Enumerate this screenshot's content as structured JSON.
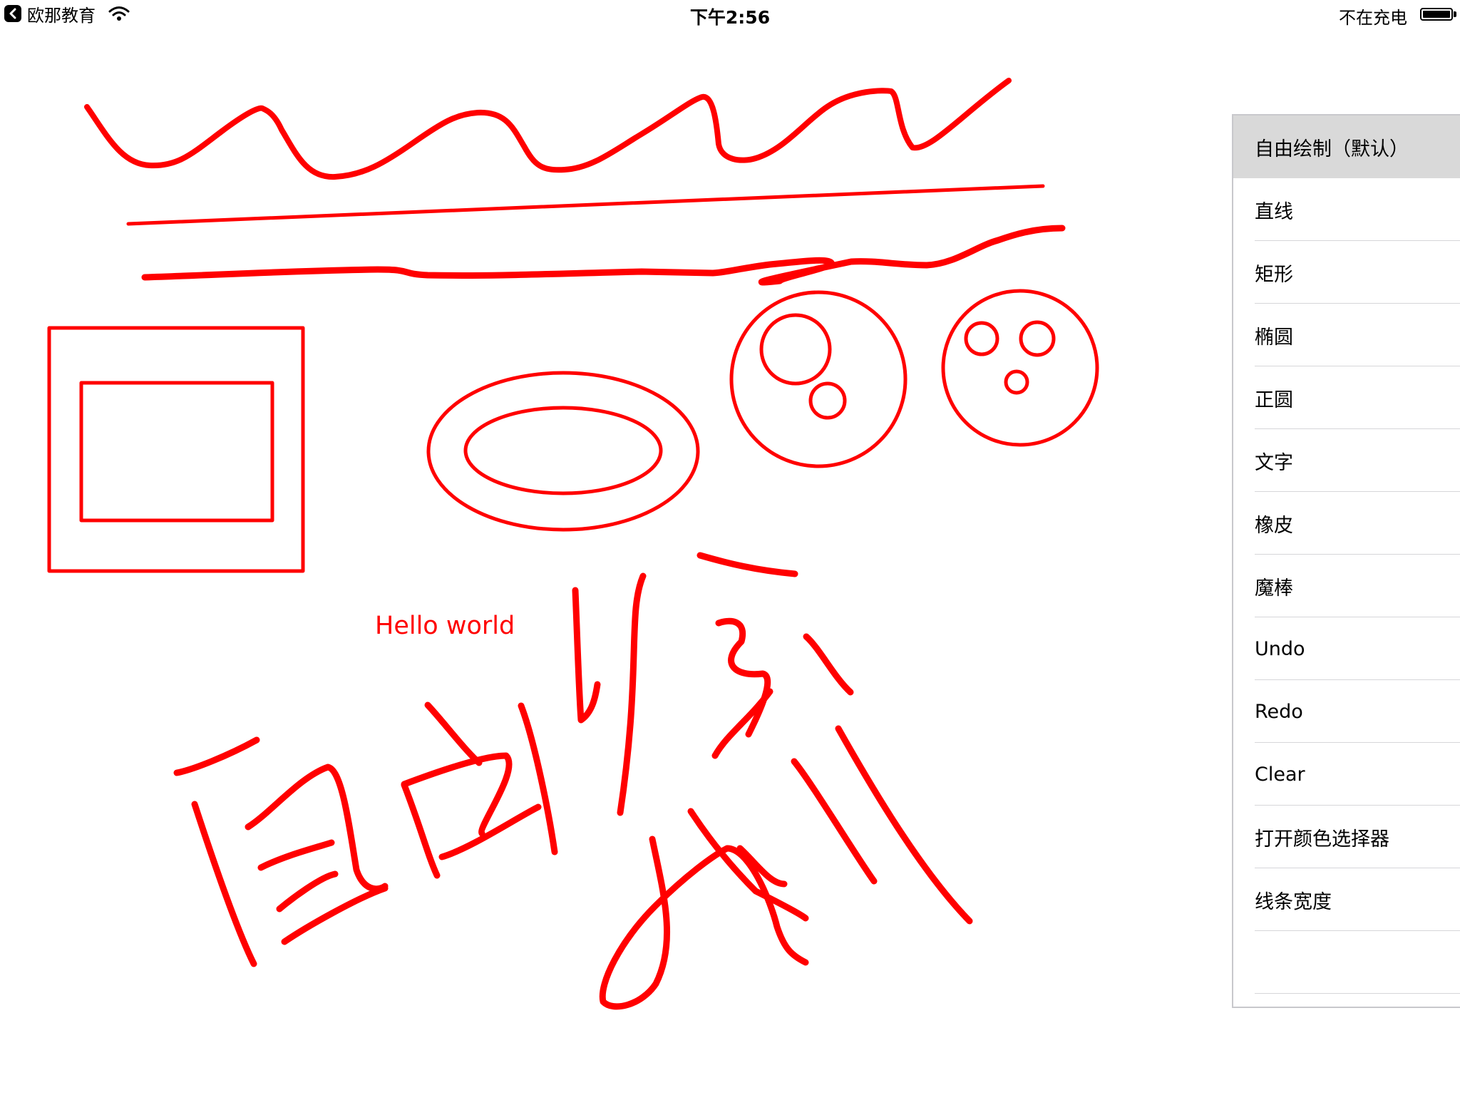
{
  "status_bar": {
    "back_app": "欧那教育",
    "time": "下午2:56",
    "battery_status": "不在充电",
    "icons": [
      "back-chevron-icon",
      "wifi-icon",
      "battery-icon"
    ]
  },
  "canvas": {
    "stroke_color": "#ff0000",
    "text_label": "Hello world"
  },
  "menu": {
    "selected_index": 0,
    "items": [
      "自由绘制（默认）",
      "直线",
      "矩形",
      "椭圆",
      "正圆",
      "文字",
      "橡皮",
      "魔棒",
      "Undo",
      "Redo",
      "Clear",
      "打开颜色选择器",
      "线条宽度",
      ""
    ]
  }
}
